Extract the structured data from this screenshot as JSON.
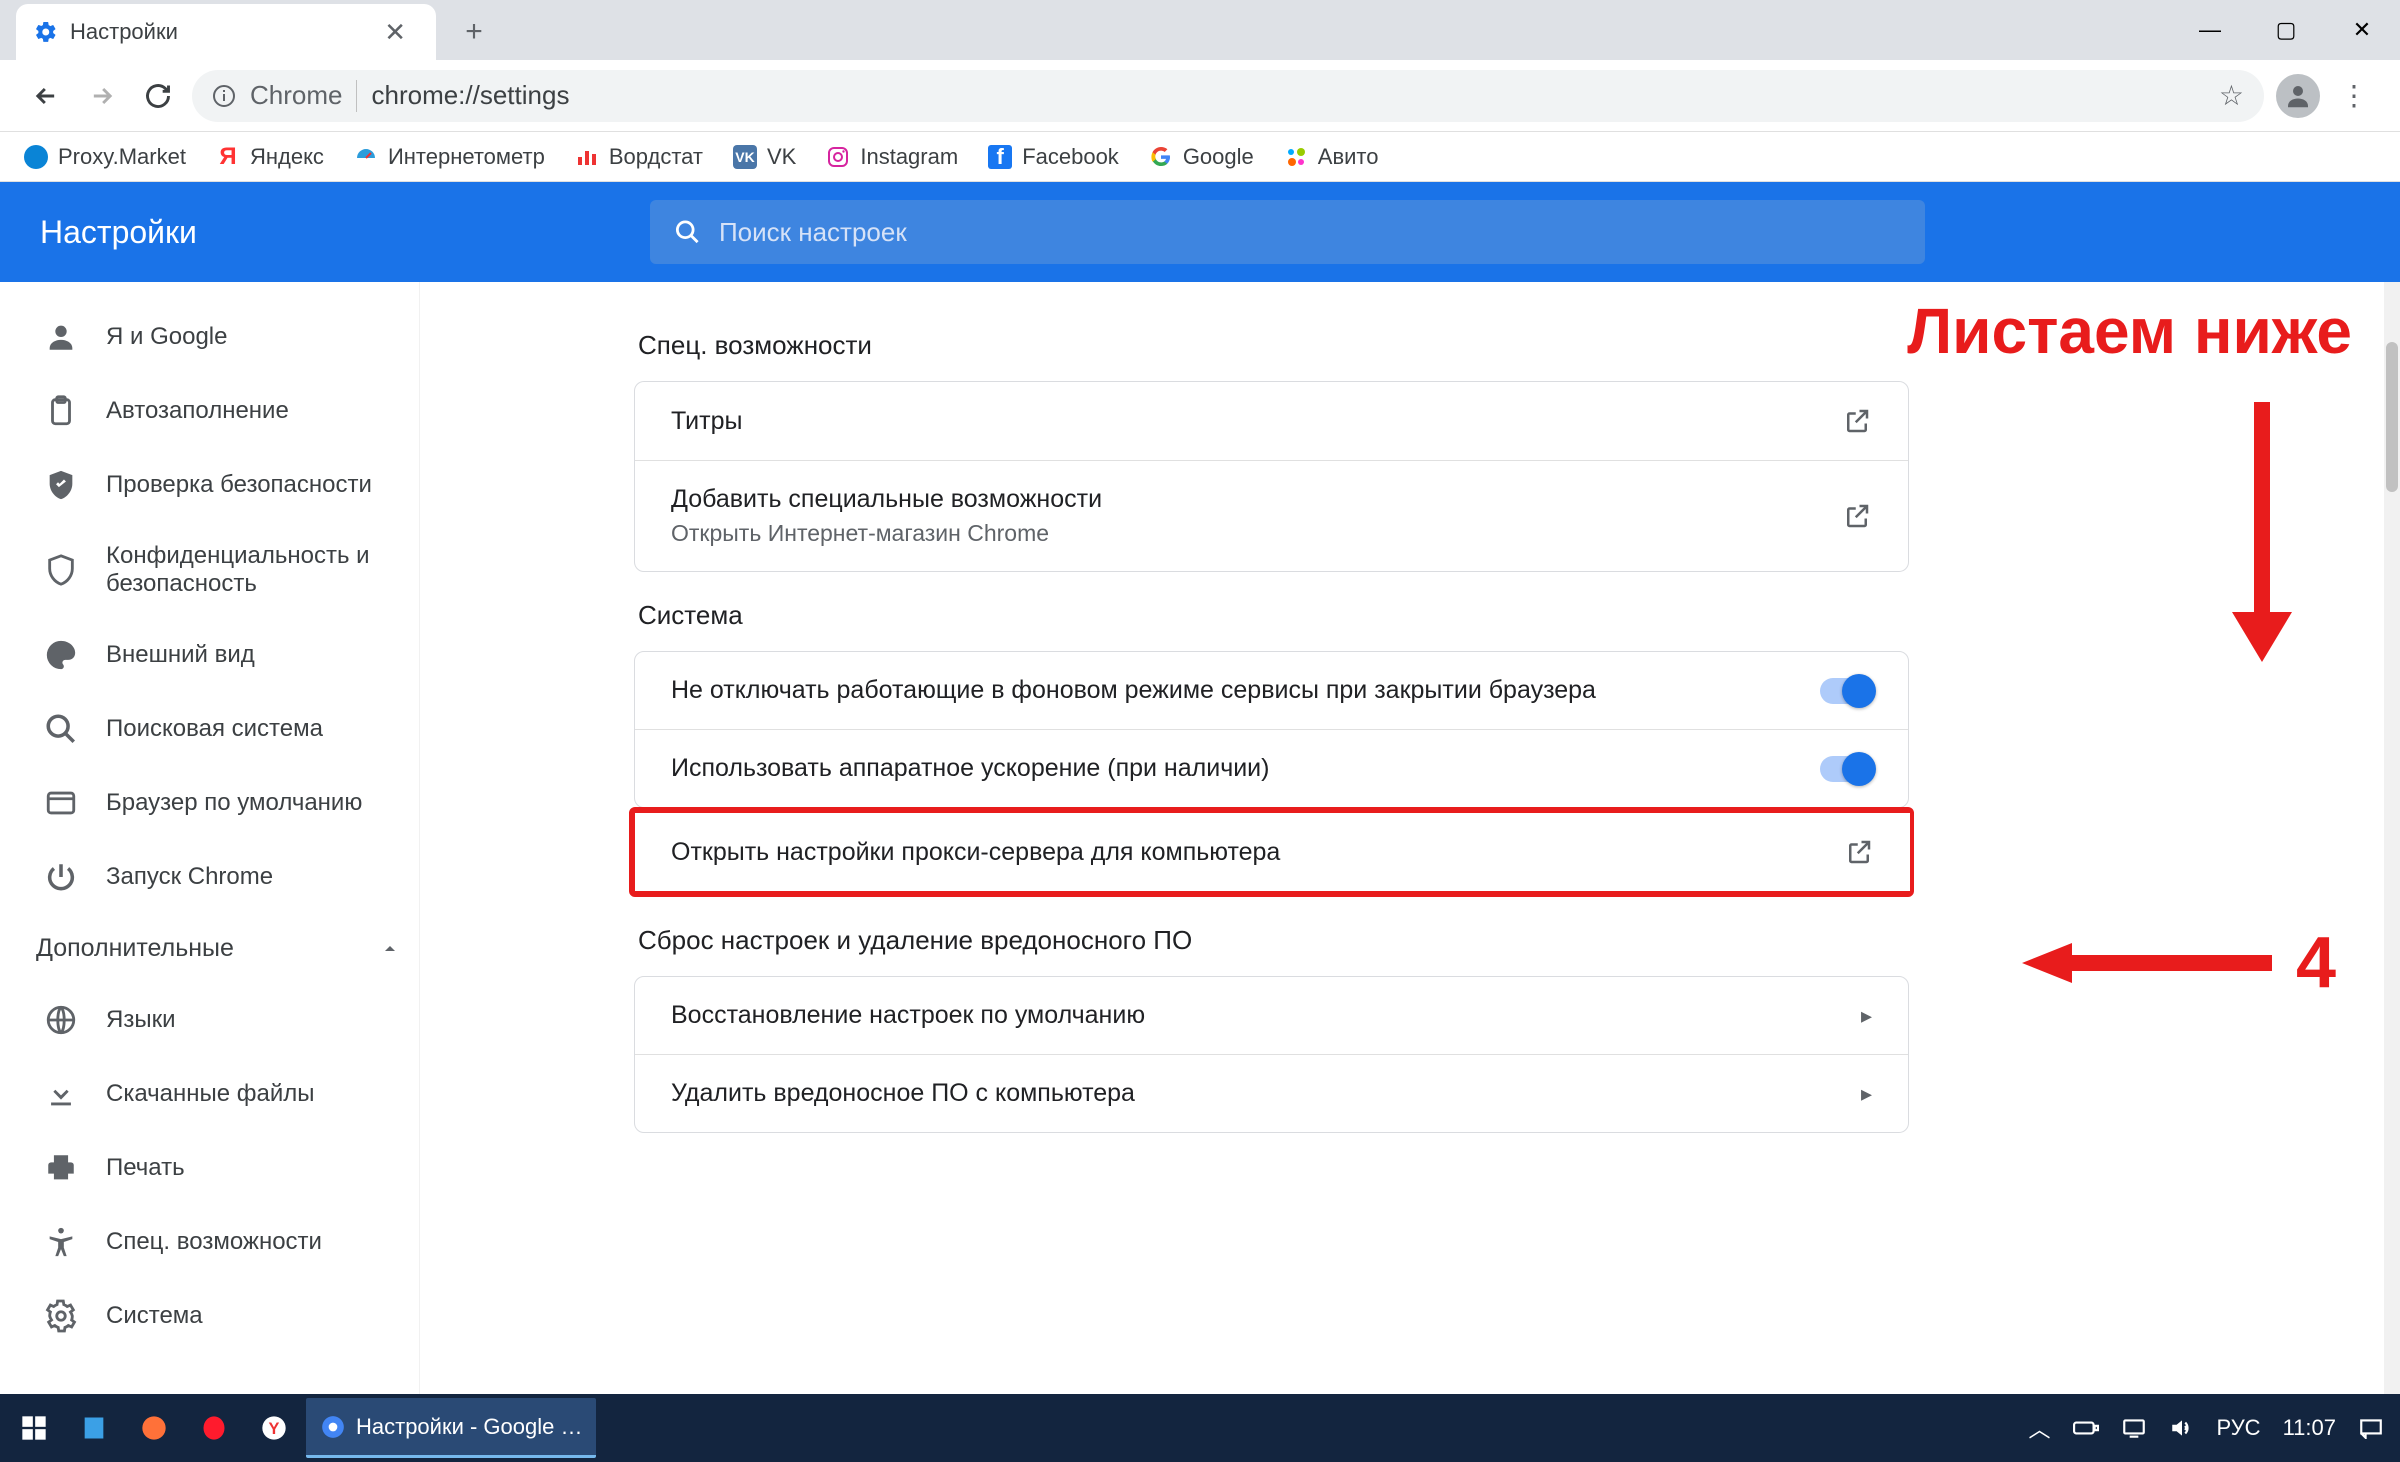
{
  "window": {
    "tab_title": "Настройки",
    "new_tab_tooltip": "+",
    "minimize": "—",
    "maximize": "▢",
    "close": "✕"
  },
  "address": {
    "chrome_label": "Chrome",
    "url": "chrome://settings"
  },
  "bookmarks": [
    {
      "icon": "proxymarket",
      "label": "Proxy.Market"
    },
    {
      "icon": "yandex",
      "label": "Яндекс"
    },
    {
      "icon": "speedtest",
      "label": "Интернетометр"
    },
    {
      "icon": "wordstat",
      "label": "Вордстат"
    },
    {
      "icon": "vk",
      "label": "VK"
    },
    {
      "icon": "instagram",
      "label": "Instagram"
    },
    {
      "icon": "facebook",
      "label": "Facebook"
    },
    {
      "icon": "google",
      "label": "Google"
    },
    {
      "icon": "avito",
      "label": "Авито"
    }
  ],
  "header": {
    "title": "Настройки",
    "search_placeholder": "Поиск настроек"
  },
  "sidebar": {
    "items": [
      {
        "icon": "person",
        "label": "Я и Google"
      },
      {
        "icon": "clipboard",
        "label": "Автозаполнение"
      },
      {
        "icon": "shield-check",
        "label": "Проверка безопасности"
      },
      {
        "icon": "shield",
        "label": "Конфиденциальность и безопасность"
      },
      {
        "icon": "palette",
        "label": "Внешний вид"
      },
      {
        "icon": "search",
        "label": "Поисковая система"
      },
      {
        "icon": "browser",
        "label": "Браузер по умолчанию"
      },
      {
        "icon": "power",
        "label": "Запуск Chrome"
      }
    ],
    "group_label": "Дополнительные",
    "adv_items": [
      {
        "icon": "globe",
        "label": "Языки"
      },
      {
        "icon": "download",
        "label": "Скачанные файлы"
      },
      {
        "icon": "print",
        "label": "Печать"
      },
      {
        "icon": "accessibility",
        "label": "Спец. возможности"
      },
      {
        "icon": "system",
        "label": "Система"
      }
    ]
  },
  "sections": {
    "a11y": {
      "title": "Спец. возможности",
      "captions": "Титры",
      "add_label": "Добавить специальные возможности",
      "add_sub": "Открыть Интернет-магазин Chrome"
    },
    "system": {
      "title": "Система",
      "bg_label": "Не отключать работающие в фоновом режиме сервисы при закрытии браузера",
      "hw_label": "Использовать аппаратное ускорение (при наличии)",
      "proxy_label": "Открыть настройки прокси-сервера для компьютера"
    },
    "reset": {
      "title": "Сброс настроек и удаление вредоносного ПО",
      "restore": "Восстановление настроек по умолчанию",
      "cleanup": "Удалить вредоносное ПО с компьютера"
    }
  },
  "annot": {
    "scroll_text": "Листаем ниже",
    "step": "4"
  },
  "taskbar": {
    "active_task": "Настройки - Google …",
    "lang": "РУС",
    "time": "11:07"
  }
}
